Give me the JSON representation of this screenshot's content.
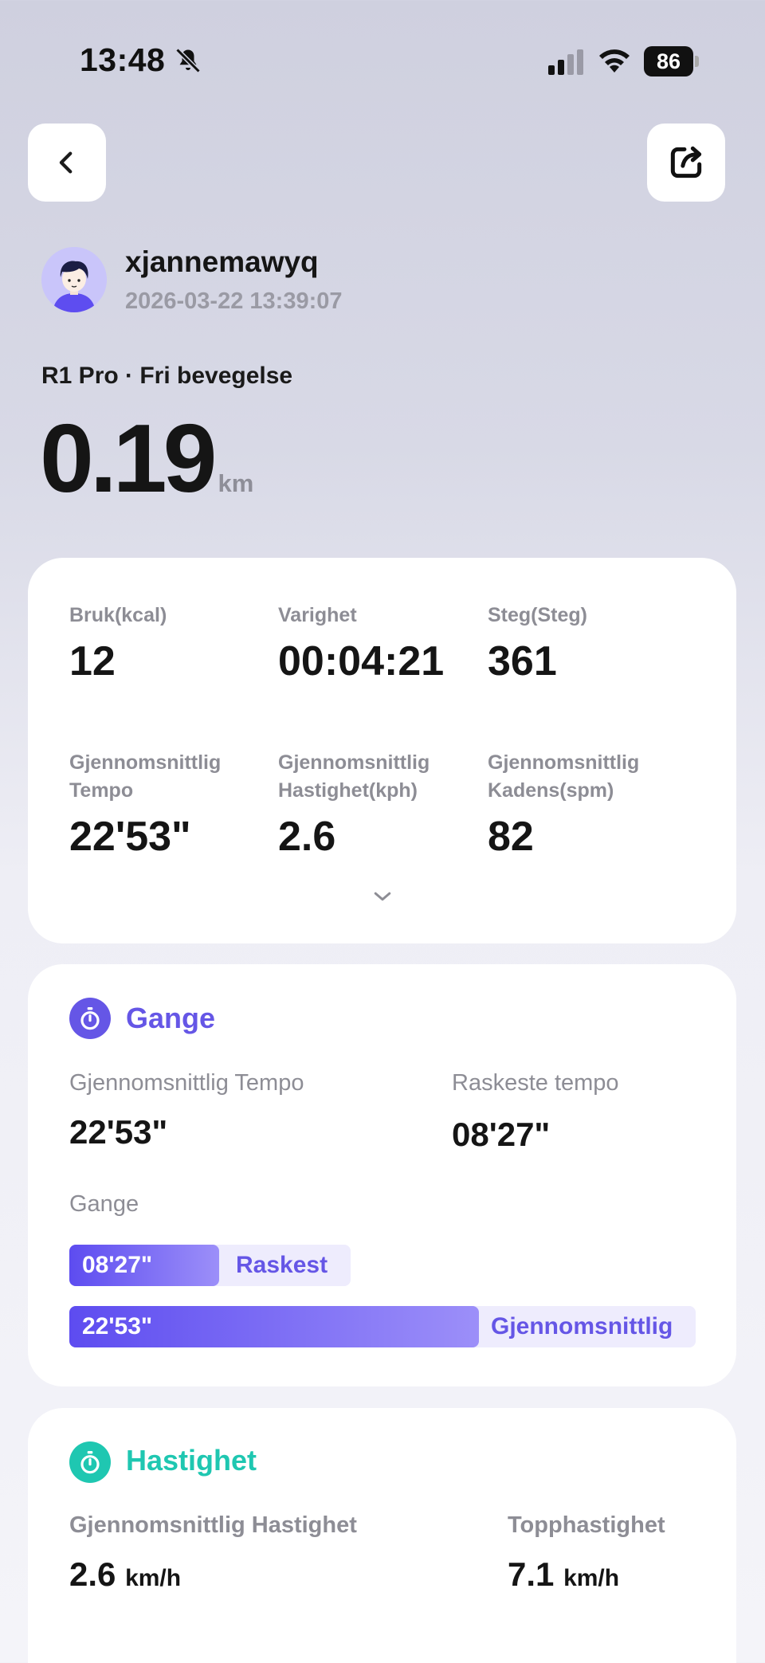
{
  "status_bar": {
    "time": "13:48",
    "battery": "86"
  },
  "user": {
    "name": "xjannemawyq",
    "datetime": "2026-03-22 13:39:07"
  },
  "activity": {
    "device_mode": "R1 Pro · Fri bevegelse",
    "distance": "0.19",
    "distance_unit": "km"
  },
  "stats": [
    {
      "label": "Bruk(kcal)",
      "value": "12"
    },
    {
      "label": "Varighet",
      "value": "00:04:21"
    },
    {
      "label": "Steg(Steg)",
      "value": "361"
    },
    {
      "label": "Gjennomsnittlig Tempo",
      "value": "22'53\""
    },
    {
      "label": "Gjennomsnittlig Hastighet(kph)",
      "value": "2.6"
    },
    {
      "label": "Gjennomsnittlig Kadens(spm)",
      "value": "82"
    }
  ],
  "walk": {
    "title": "Gange",
    "avg_pace_label": "Gjennomsnittlig Tempo",
    "avg_pace_value": "22'53\"",
    "fastest_pace_label": "Raskeste tempo",
    "fastest_pace_value": "08'27\"",
    "chart_label": "Gange",
    "bars": [
      {
        "value": "08'27\"",
        "label": "Raskest"
      },
      {
        "value": "22'53\"",
        "label": "Gjennomsnittlig"
      }
    ]
  },
  "speed": {
    "title": "Hastighet",
    "avg_label": "Gjennomsnittlig Hastighet",
    "avg_value": "2.6",
    "top_label": "Topphastighet",
    "top_value": "7.1",
    "unit": "km/h"
  },
  "colors": {
    "accent_purple": "#6556e6",
    "accent_teal": "#1fc7b1"
  },
  "icons": {
    "back": "chevron-left-icon",
    "share": "share-icon",
    "bell": "bell-slash-icon",
    "expand": "chevron-down-icon",
    "walk": "stopwatch-icon",
    "speed": "timer-icon"
  }
}
